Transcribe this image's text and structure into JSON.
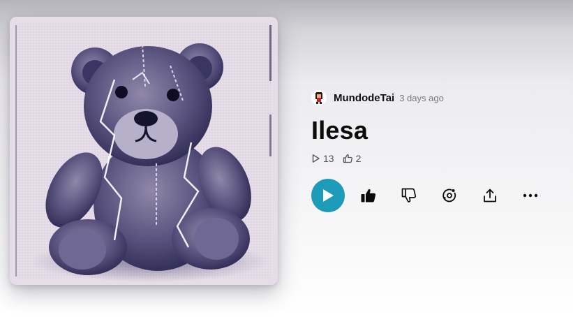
{
  "track": {
    "artist": "MundodeTai",
    "posted": "3 days ago",
    "title": "Ilesa",
    "plays": "13",
    "likes": "2"
  },
  "colors": {
    "play_button": "#1e9bb8",
    "title_text": "#0b0b0b",
    "muted_text": "#7a7a80"
  },
  "icons": [
    "play-icon",
    "thumbs-up-icon",
    "thumbs-down-icon",
    "remix-icon",
    "share-icon",
    "more-icon"
  ]
}
